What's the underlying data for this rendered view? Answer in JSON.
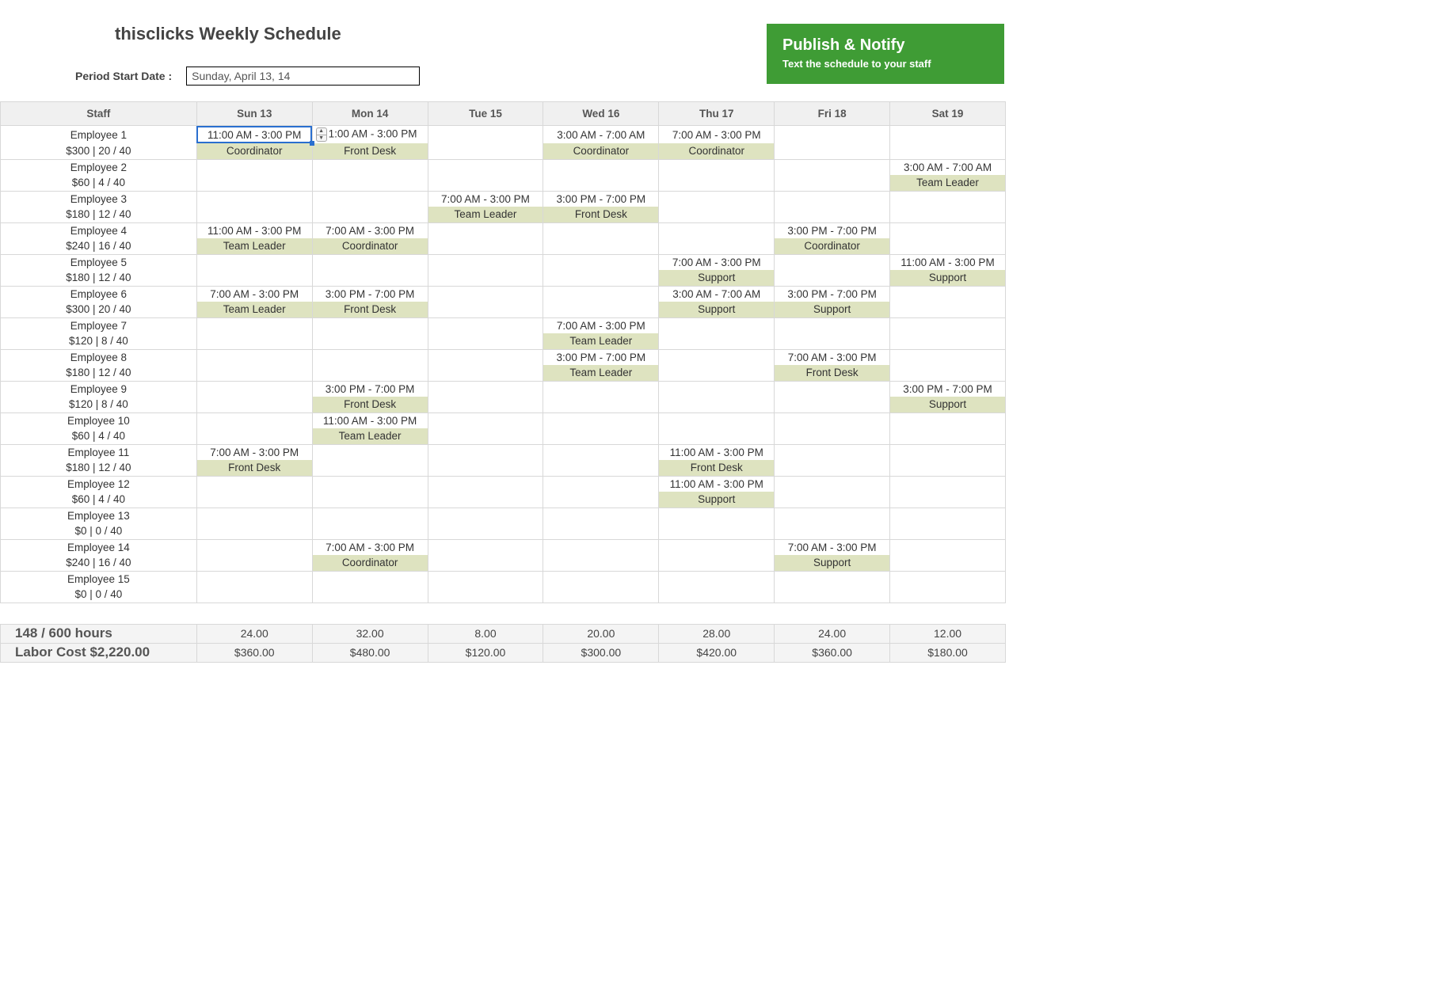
{
  "title": "thisclicks Weekly Schedule",
  "period_label": "Period Start Date :",
  "period_value": "Sunday, April 13, 14",
  "publish": {
    "title": "Publish & Notify",
    "sub": "Text the schedule to your staff"
  },
  "columns": [
    "Staff",
    "Sun 13",
    "Mon 14",
    "Tue 15",
    "Wed 16",
    "Thu 17",
    "Fri 18",
    "Sat 19"
  ],
  "employees": [
    {
      "name": "Employee 1",
      "stat": "$300 | 20 / 40",
      "shifts": [
        {
          "time": "11:00 AM - 3:00 PM",
          "role": "Coordinator"
        },
        {
          "time": "1:00 AM - 3:00 PM",
          "role": "Front Desk"
        },
        null,
        {
          "time": "3:00 AM - 7:00 AM",
          "role": "Coordinator"
        },
        {
          "time": "7:00 AM - 3:00 PM",
          "role": "Coordinator"
        },
        null,
        null
      ]
    },
    {
      "name": "Employee 2",
      "stat": "$60 | 4 / 40",
      "shifts": [
        null,
        null,
        null,
        null,
        null,
        null,
        {
          "time": "3:00 AM - 7:00 AM",
          "role": "Team Leader"
        }
      ]
    },
    {
      "name": "Employee 3",
      "stat": "$180 | 12 / 40",
      "shifts": [
        null,
        null,
        {
          "time": "7:00 AM - 3:00 PM",
          "role": "Team Leader"
        },
        {
          "time": "3:00 PM - 7:00 PM",
          "role": "Front Desk"
        },
        null,
        null,
        null
      ]
    },
    {
      "name": "Employee 4",
      "stat": "$240 | 16 / 40",
      "shifts": [
        {
          "time": "11:00 AM - 3:00 PM",
          "role": "Team Leader"
        },
        {
          "time": "7:00 AM - 3:00 PM",
          "role": "Coordinator"
        },
        null,
        null,
        null,
        {
          "time": "3:00 PM - 7:00 PM",
          "role": "Coordinator"
        },
        null
      ]
    },
    {
      "name": "Employee 5",
      "stat": "$180 | 12 / 40",
      "shifts": [
        null,
        null,
        null,
        null,
        {
          "time": "7:00 AM - 3:00 PM",
          "role": "Support"
        },
        null,
        {
          "time": "11:00 AM - 3:00 PM",
          "role": "Support"
        }
      ]
    },
    {
      "name": "Employee 6",
      "stat": "$300 | 20 / 40",
      "shifts": [
        {
          "time": "7:00 AM - 3:00 PM",
          "role": "Team Leader"
        },
        {
          "time": "3:00 PM - 7:00 PM",
          "role": "Front Desk"
        },
        null,
        null,
        {
          "time": "3:00 AM - 7:00 AM",
          "role": "Support"
        },
        {
          "time": "3:00 PM - 7:00 PM",
          "role": "Support"
        },
        null
      ]
    },
    {
      "name": "Employee 7",
      "stat": "$120 | 8 / 40",
      "shifts": [
        null,
        null,
        null,
        {
          "time": "7:00 AM - 3:00 PM",
          "role": "Team Leader"
        },
        null,
        null,
        null
      ]
    },
    {
      "name": "Employee 8",
      "stat": "$180 | 12 / 40",
      "shifts": [
        null,
        null,
        null,
        {
          "time": "3:00 PM - 7:00 PM",
          "role": "Team Leader"
        },
        null,
        {
          "time": "7:00 AM - 3:00 PM",
          "role": "Front Desk"
        },
        null
      ]
    },
    {
      "name": "Employee 9",
      "stat": "$120 | 8 / 40",
      "shifts": [
        null,
        {
          "time": "3:00 PM - 7:00 PM",
          "role": "Front Desk"
        },
        null,
        null,
        null,
        null,
        {
          "time": "3:00 PM - 7:00 PM",
          "role": "Support"
        }
      ]
    },
    {
      "name": "Employee 10",
      "stat": "$60 | 4 / 40",
      "shifts": [
        null,
        {
          "time": "11:00 AM - 3:00 PM",
          "role": "Team Leader"
        },
        null,
        null,
        null,
        null,
        null
      ]
    },
    {
      "name": "Employee 11",
      "stat": "$180 | 12 / 40",
      "shifts": [
        {
          "time": "7:00 AM - 3:00 PM",
          "role": "Front Desk"
        },
        null,
        null,
        null,
        {
          "time": "11:00 AM - 3:00 PM",
          "role": "Front Desk"
        },
        null,
        null
      ]
    },
    {
      "name": "Employee 12",
      "stat": "$60 | 4 / 40",
      "shifts": [
        null,
        null,
        null,
        null,
        {
          "time": "11:00 AM - 3:00 PM",
          "role": "Support"
        },
        null,
        null
      ]
    },
    {
      "name": "Employee 13",
      "stat": "$0 | 0 / 40",
      "shifts": [
        null,
        null,
        null,
        null,
        null,
        null,
        null
      ]
    },
    {
      "name": "Employee 14",
      "stat": "$240 | 16 / 40",
      "shifts": [
        null,
        {
          "time": "7:00 AM - 3:00 PM",
          "role": "Coordinator"
        },
        null,
        null,
        null,
        {
          "time": "7:00 AM - 3:00 PM",
          "role": "Support"
        },
        null
      ]
    },
    {
      "name": "Employee 15",
      "stat": "$0 | 0 / 40",
      "shifts": [
        null,
        null,
        null,
        null,
        null,
        null,
        null
      ]
    }
  ],
  "summary": {
    "hours_label": "148 / 600 hours",
    "hours": [
      "24.00",
      "32.00",
      "8.00",
      "20.00",
      "28.00",
      "24.00",
      "12.00"
    ],
    "cost_label": "Labor Cost $2,220.00",
    "costs": [
      "$360.00",
      "$480.00",
      "$120.00",
      "$300.00",
      "$420.00",
      "$360.00",
      "$180.00"
    ]
  }
}
